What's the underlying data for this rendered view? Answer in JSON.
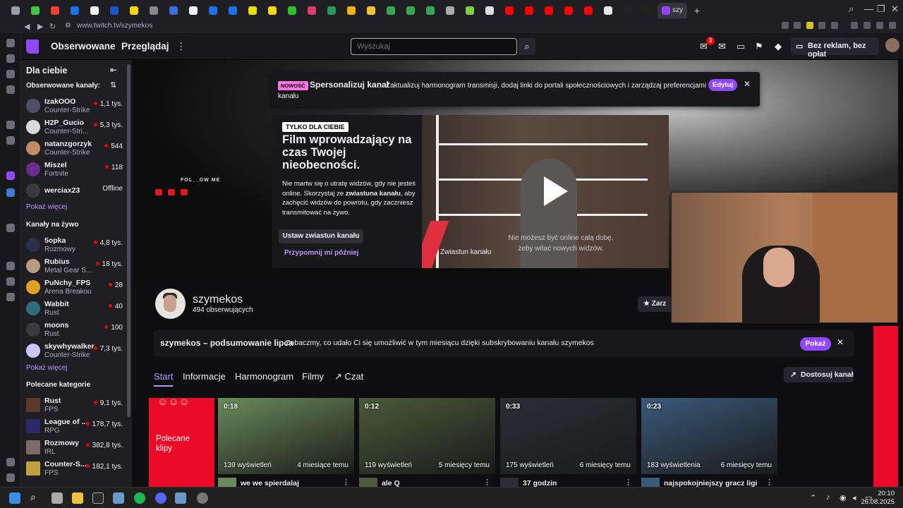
{
  "browser": {
    "active_tab_label": "szy",
    "url": "www.twitch.tv/szymekos"
  },
  "nav": {
    "following": "Obserwowane",
    "browse": "Przeglądaj",
    "search_placeholder": "Wyszukaj",
    "notif_count": "3",
    "adfree": "Bez reklam, bez opłat"
  },
  "sidebar": {
    "for_you": "Dla ciebie",
    "followed_header": "Obserwowane kanały:",
    "followed": [
      {
        "name": "IzakOOO",
        "game": "Counter-Strike",
        "viewers": "1,1 tys.",
        "color": "#4a4f6a"
      },
      {
        "name": "H2P_Gucio",
        "game": "Counter-Stri...",
        "viewers": "5,3 tys.",
        "color": "#d8d8d8"
      },
      {
        "name": "natanzgorzyk",
        "game": "Counter-Strike",
        "viewers": "544",
        "color": "#c28a66"
      },
      {
        "name": "Miszel",
        "game": "Fortnite",
        "viewers": "118",
        "color": "#6b2b8a"
      },
      {
        "name": "werciax23",
        "game": "",
        "viewers": "Offline",
        "color": "#3a3a3d"
      }
    ],
    "show_more": "Pokaż więcej",
    "live_header": "Kanały na żywo",
    "live": [
      {
        "name": "5opka",
        "game": "Rozmowy",
        "viewers": "4,8 tys.",
        "color": "#2a2f4a"
      },
      {
        "name": "Rubius",
        "game": "Metal Gear S...",
        "viewers": "18 tys.",
        "color": "#b89a80"
      },
      {
        "name": "PuNchy_FPS",
        "game": "Arena Breakout...",
        "viewers": "28",
        "color": "#e0a020"
      },
      {
        "name": "Wabbit",
        "game": "Rust",
        "viewers": "40",
        "color": "#2e6c7a"
      },
      {
        "name": "moons",
        "game": "Rust",
        "viewers": "100",
        "color": "#3c3c3c"
      },
      {
        "name": "skywhywalker",
        "game": "Counter-Strike",
        "viewers": "7,3 tys.",
        "color": "#c8c8ff"
      }
    ],
    "show_more_2": "Pokaż więcej",
    "cat_header": "Polecane kategorie",
    "categories": [
      {
        "name": "Rust",
        "game": "FPS",
        "viewers": "9,1 tys.",
        "color": "#5a3a2a"
      },
      {
        "name": "League of ...",
        "game": "RPG",
        "viewers": "178,7 tys.",
        "color": "#2a2a6a"
      },
      {
        "name": "Rozmowy",
        "game": "IRL",
        "viewers": "382,8 tys.",
        "color": "#7a6a6a"
      },
      {
        "name": "Counter-S...",
        "game": "FPS",
        "viewers": "182,1 tys.",
        "color": "#c0a040"
      }
    ]
  },
  "notice": {
    "tag": "NOWOŚĆ",
    "title": "Spersonalizuj kanał",
    "text": "Zaktualizuj harmonogram transmisji, dodaj linki do portali społecznościowych i zarządzaj preferencjami kanału",
    "button": "Edytuj"
  },
  "banner": {
    "follow_text": "FOL__OW ME"
  },
  "promo": {
    "tag": "TYLKO DLA CIEBIE",
    "title": "Film wprowadzający na czas Twojej nieobecności.",
    "text_1": "Nie martw się o utratę widzów, gdy nie jesteś online. Skorzystaj ze ",
    "text_bold": "zwiastuna kanału",
    "text_2": ", aby zachęcić widzów do powrotu, gdy zaczniesz transmitować na żywo.",
    "button": "Ustaw zwiastun kanału",
    "later": "Przypomnij mi później"
  },
  "video": {
    "caption": "Nie możesz być online całą dobę, żeby witać nowych widzów.",
    "label": "Zwiastun kanału"
  },
  "profile": {
    "name": "szymekos",
    "followers": "494 obserwujących",
    "action": "Zarz"
  },
  "summary": {
    "title": "szymekos – podsumowanie lipca",
    "text": "Zobaczmy, co udało Ci się umożliwić w tym miesiącu dzięki subskrybowaniu kanału szymekos",
    "button": "Pokaż"
  },
  "tabs": [
    "Start",
    "Informacje",
    "Harmonogram",
    "Filmy",
    "Czat"
  ],
  "customize": "Dostosuj kanał",
  "featured": "Polecane klipy",
  "clips": [
    {
      "duration": "0:18",
      "views": "139 wyświetleń",
      "ago": "4 miesiące temu",
      "title": "we we spierdalaj",
      "color": "#6a8a5a"
    },
    {
      "duration": "0:12",
      "views": "119 wyświetleń",
      "ago": "5 miesięcy temu",
      "title": "ale Q",
      "color": "#4a5a3a"
    },
    {
      "duration": "0:33",
      "views": "175 wyświetleń",
      "ago": "6 miesięcy temu",
      "title": "37 godzin",
      "color": "#2a2e34"
    },
    {
      "duration": "0:23",
      "views": "183 wyświetlenia",
      "ago": "6 miesięcy temu",
      "title": "najspokojniejszy gracz ligi",
      "color": "#3a5a7a"
    }
  ],
  "taskbar": {
    "time": "20:10",
    "date": "26.08.2025"
  }
}
